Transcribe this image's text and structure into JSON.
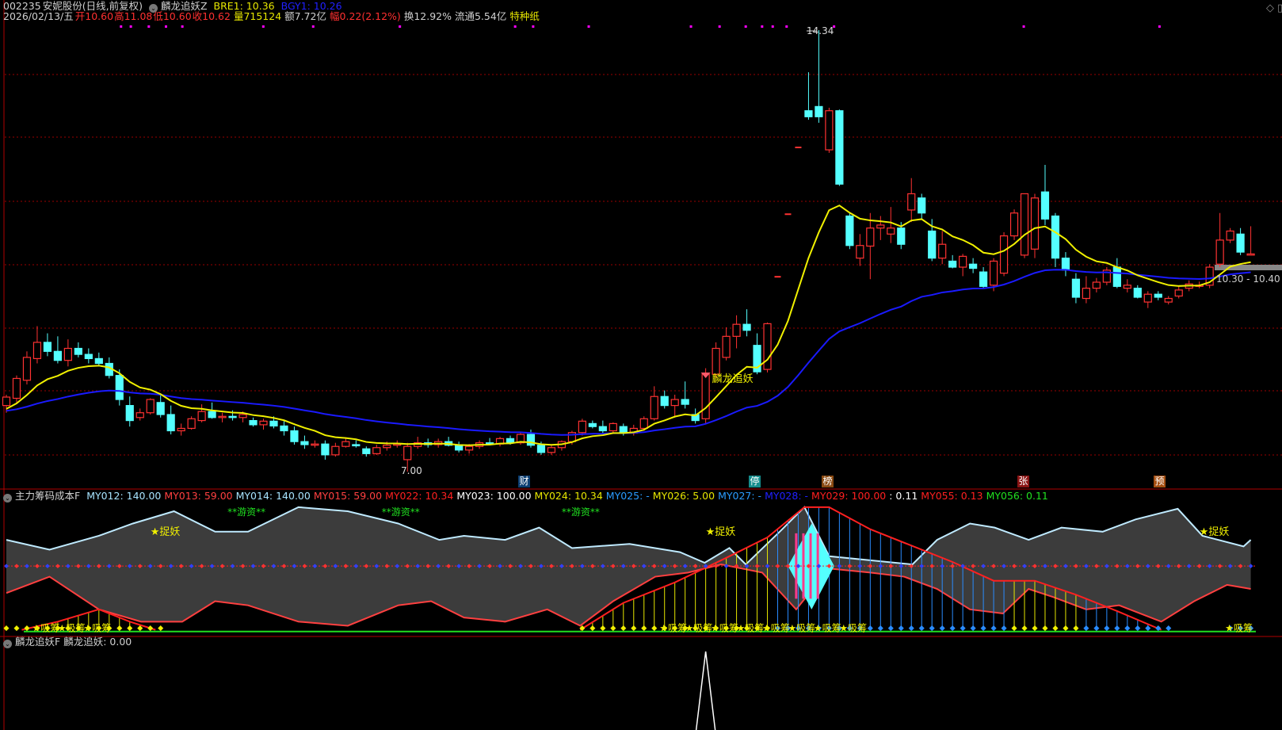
{
  "header": {
    "code": "002235",
    "name": "安妮股份",
    "period": "(日线,前复权)",
    "indicator": "麟龙追妖Z",
    "bre1": "BRE1: 10.36",
    "bgy1": "BGY1: 10.26",
    "date": "2026/02/13/五",
    "open": "开10.60",
    "high": "高11.08",
    "low": "低10.60",
    "close": "收10.62",
    "volume": "量715124",
    "amount": "额7.72亿",
    "change": "幅0.22(2.12%)",
    "turnover": "换12.92%",
    "float": "流通5.54亿",
    "tag": "特种纸"
  },
  "price_labels": {
    "high": "14.34",
    "low": "7.00",
    "range": "10.30 - 10.40",
    "signal": "麟龙追妖"
  },
  "events": [
    {
      "label": "财",
      "color": "#0b3e72"
    },
    {
      "label": "停",
      "color": "#158c8c"
    },
    {
      "label": "榜",
      "color": "#8a4a12"
    },
    {
      "label": "张",
      "color": "#8a1414"
    },
    {
      "label": "预",
      "color": "#a54f12"
    }
  ],
  "indicator_header": {
    "name": "主力筹码成本F",
    "items": [
      {
        "text": "MY012: 140.00",
        "color": "#a8e4ff"
      },
      {
        "text": "MY013: 59.00",
        "color": "#ff4040"
      },
      {
        "text": "MY014: 140.00",
        "color": "#a8e4ff"
      },
      {
        "text": "MY015: 59.00",
        "color": "#ff4040"
      },
      {
        "text": "MY022: 10.34",
        "color": "#ff2020"
      },
      {
        "text": "MY023: 100.00",
        "color": "#ffffff"
      },
      {
        "text": "MY024: 10.34",
        "color": "#e6e600"
      },
      {
        "text": "MY025: -",
        "color": "#2a9cff"
      },
      {
        "text": "MY026: 5.00",
        "color": "#e6e600"
      },
      {
        "text": "MY027: -",
        "color": "#2a9cff"
      },
      {
        "text": "MY028: -",
        "color": "#2020ff"
      },
      {
        "text": "MY029: 100.00",
        "color": "#ff2020"
      },
      {
        "text": ": 0.11",
        "color": "#ffffff"
      },
      {
        "text": "MY055: 0.13",
        "color": "#ff2020"
      },
      {
        "text": "MY056: 0.11",
        "color": "#20e020"
      }
    ],
    "labels": {
      "catch": "★捉妖",
      "hot": "**游资**",
      "absorb": "★吸筹"
    }
  },
  "bottom_header": {
    "name": "麟龙追妖F",
    "value": "麟龙追妖: 0.00"
  },
  "colors": {
    "up": "#ff3232",
    "down": "#54ffff",
    "ma_short": "#f0f000",
    "ma_long": "#1a1aff",
    "grid": "#9a0000"
  },
  "chart_data": {
    "type": "candlestick",
    "ylim": [
      7.0,
      14.34
    ],
    "ohlc": [
      [
        8.1,
        8.28,
        7.98,
        8.24
      ],
      [
        8.22,
        8.6,
        8.15,
        8.55
      ],
      [
        8.52,
        9.0,
        8.45,
        8.9
      ],
      [
        8.88,
        9.42,
        8.8,
        9.15
      ],
      [
        9.15,
        9.3,
        8.92,
        9.0
      ],
      [
        9.0,
        9.25,
        8.8,
        8.85
      ],
      [
        8.85,
        9.2,
        8.75,
        9.05
      ],
      [
        9.05,
        9.15,
        8.9,
        8.95
      ],
      [
        8.95,
        9.05,
        8.8,
        8.88
      ],
      [
        8.88,
        8.98,
        8.75,
        8.8
      ],
      [
        8.8,
        8.9,
        8.55,
        8.6
      ],
      [
        8.6,
        8.7,
        8.1,
        8.2
      ],
      [
        8.1,
        8.25,
        7.75,
        7.85
      ],
      [
        7.9,
        8.05,
        7.85,
        7.98
      ],
      [
        7.98,
        8.22,
        7.95,
        8.2
      ],
      [
        8.15,
        8.3,
        7.9,
        7.95
      ],
      [
        7.95,
        8.1,
        7.62,
        7.68
      ],
      [
        7.68,
        7.8,
        7.6,
        7.72
      ],
      [
        7.72,
        7.92,
        7.7,
        7.88
      ],
      [
        7.85,
        8.12,
        7.82,
        8.0
      ],
      [
        8.0,
        8.15,
        7.88,
        7.9
      ],
      [
        7.9,
        7.98,
        7.82,
        7.92
      ],
      [
        7.92,
        8.02,
        7.85,
        7.9
      ],
      [
        7.9,
        8.0,
        7.82,
        7.95
      ],
      [
        7.85,
        7.9,
        7.75,
        7.78
      ],
      [
        7.78,
        7.88,
        7.7,
        7.84
      ],
      [
        7.84,
        7.92,
        7.72,
        7.76
      ],
      [
        7.76,
        7.85,
        7.6,
        7.68
      ],
      [
        7.68,
        7.75,
        7.45,
        7.5
      ],
      [
        7.5,
        7.6,
        7.38,
        7.45
      ],
      [
        7.45,
        7.52,
        7.4,
        7.46
      ],
      [
        7.46,
        7.52,
        7.2,
        7.28
      ],
      [
        7.28,
        7.48,
        7.25,
        7.42
      ],
      [
        7.42,
        7.55,
        7.4,
        7.5
      ],
      [
        7.45,
        7.52,
        7.4,
        7.44
      ],
      [
        7.38,
        7.42,
        7.25,
        7.3
      ],
      [
        7.3,
        7.45,
        7.28,
        7.4
      ],
      [
        7.4,
        7.5,
        7.35,
        7.44
      ],
      [
        7.44,
        7.52,
        7.4,
        7.46
      ],
      [
        7.2,
        7.48,
        7.0,
        7.42
      ],
      [
        7.42,
        7.58,
        7.38,
        7.48
      ],
      [
        7.48,
        7.55,
        7.4,
        7.45
      ],
      [
        7.45,
        7.55,
        7.4,
        7.5
      ],
      [
        7.5,
        7.58,
        7.42,
        7.44
      ],
      [
        7.44,
        7.5,
        7.32,
        7.36
      ],
      [
        7.36,
        7.46,
        7.3,
        7.42
      ],
      [
        7.42,
        7.52,
        7.38,
        7.48
      ],
      [
        7.48,
        7.56,
        7.44,
        7.46
      ],
      [
        7.46,
        7.58,
        7.42,
        7.55
      ],
      [
        7.55,
        7.6,
        7.45,
        7.48
      ],
      [
        7.48,
        7.66,
        7.45,
        7.62
      ],
      [
        7.62,
        7.7,
        7.4,
        7.44
      ],
      [
        7.44,
        7.5,
        7.28,
        7.32
      ],
      [
        7.32,
        7.45,
        7.28,
        7.4
      ],
      [
        7.4,
        7.52,
        7.35,
        7.5
      ],
      [
        7.5,
        7.68,
        7.45,
        7.65
      ],
      [
        7.65,
        7.88,
        7.6,
        7.84
      ],
      [
        7.8,
        7.85,
        7.72,
        7.75
      ],
      [
        7.75,
        7.85,
        7.62,
        7.68
      ],
      [
        7.68,
        7.82,
        7.64,
        7.8
      ],
      [
        7.75,
        7.8,
        7.6,
        7.64
      ],
      [
        7.64,
        7.78,
        7.6,
        7.72
      ],
      [
        7.72,
        7.92,
        7.68,
        7.88
      ],
      [
        7.88,
        8.42,
        7.85,
        8.25
      ],
      [
        8.25,
        8.35,
        8.05,
        8.1
      ],
      [
        8.1,
        8.28,
        7.9,
        8.2
      ],
      [
        8.2,
        8.5,
        8.05,
        8.12
      ],
      [
        7.95,
        8.05,
        7.8,
        7.85
      ],
      [
        7.88,
        8.72,
        7.8,
        8.62
      ],
      [
        8.62,
        9.15,
        8.55,
        9.05
      ],
      [
        8.9,
        9.4,
        8.85,
        9.25
      ],
      [
        9.25,
        9.6,
        9.05,
        9.45
      ],
      [
        9.45,
        9.7,
        9.25,
        9.35
      ],
      [
        9.1,
        9.3,
        8.62,
        8.66
      ],
      [
        8.7,
        9.48,
        8.65,
        9.46
      ],
      [
        10.24,
        10.24,
        10.24,
        10.24
      ],
      [
        11.28,
        11.28,
        11.28,
        11.28
      ],
      [
        12.39,
        12.39,
        12.39,
        12.39
      ],
      [
        13.0,
        13.64,
        12.85,
        12.9
      ],
      [
        13.07,
        14.34,
        12.8,
        12.9
      ],
      [
        12.35,
        13.05,
        12.3,
        13.0
      ],
      [
        13.0,
        13.02,
        11.75,
        11.78
      ],
      [
        11.25,
        11.3,
        10.7,
        10.76
      ],
      [
        10.55,
        10.95,
        10.42,
        10.76
      ],
      [
        10.75,
        11.3,
        10.2,
        11.05
      ],
      [
        11.05,
        11.25,
        10.85,
        11.1
      ],
      [
        10.95,
        11.4,
        10.8,
        11.05
      ],
      [
        11.05,
        11.15,
        10.7,
        10.78
      ],
      [
        11.35,
        11.88,
        11.15,
        11.62
      ],
      [
        11.55,
        11.62,
        11.2,
        11.3
      ],
      [
        11.0,
        11.2,
        10.5,
        10.55
      ],
      [
        10.55,
        11.0,
        10.45,
        10.78
      ],
      [
        10.5,
        10.6,
        10.38,
        10.4
      ],
      [
        10.4,
        10.62,
        10.25,
        10.58
      ],
      [
        10.45,
        10.55,
        10.3,
        10.38
      ],
      [
        10.32,
        10.4,
        10.05,
        10.08
      ],
      [
        10.1,
        10.55,
        10.0,
        10.5
      ],
      [
        10.3,
        10.98,
        10.25,
        10.92
      ],
      [
        10.92,
        11.36,
        10.85,
        11.3
      ],
      [
        10.6,
        11.62,
        10.55,
        11.62
      ],
      [
        10.7,
        11.62,
        10.55,
        11.55
      ],
      [
        11.65,
        12.1,
        11.1,
        11.2
      ],
      [
        11.25,
        11.3,
        10.4,
        10.55
      ],
      [
        10.55,
        10.65,
        10.25,
        10.35
      ],
      [
        10.2,
        10.3,
        9.8,
        9.9
      ],
      [
        9.88,
        10.25,
        9.8,
        10.05
      ],
      [
        10.05,
        10.22,
        9.98,
        10.15
      ],
      [
        10.15,
        10.4,
        10.1,
        10.35
      ],
      [
        10.4,
        10.55,
        10.05,
        10.08
      ],
      [
        10.05,
        10.2,
        9.98,
        10.1
      ],
      [
        10.05,
        10.1,
        9.88,
        9.9
      ],
      [
        9.82,
        10.0,
        9.72,
        9.95
      ],
      [
        9.95,
        10.0,
        9.85,
        9.9
      ],
      [
        9.82,
        9.92,
        9.78,
        9.88
      ],
      [
        9.92,
        10.08,
        9.88,
        10.02
      ],
      [
        10.05,
        10.18,
        10.0,
        10.12
      ],
      [
        10.1,
        10.16,
        10.05,
        10.1
      ],
      [
        10.1,
        10.45,
        10.05,
        10.4
      ],
      [
        10.45,
        11.3,
        10.4,
        10.85
      ],
      [
        10.85,
        11.05,
        10.8,
        11.0
      ],
      [
        10.95,
        11.05,
        10.6,
        10.65
      ],
      [
        10.6,
        11.08,
        10.6,
        10.62
      ]
    ],
    "indicator": {
      "upper": [
        [
          0,
          32
        ],
        [
          4.2,
          20
        ],
        [
          9,
          37
        ],
        [
          12.3,
          52
        ],
        [
          16.3,
          67
        ],
        [
          20.3,
          42
        ],
        [
          23.5,
          42
        ],
        [
          28.4,
          72
        ],
        [
          33.2,
          67
        ],
        [
          38.1,
          52
        ],
        [
          42.1,
          32
        ],
        [
          44.5,
          37
        ],
        [
          48.5,
          32
        ],
        [
          51.8,
          47
        ],
        [
          55,
          22
        ],
        [
          60.6,
          27
        ],
        [
          65.5,
          17
        ],
        [
          67.9,
          4
        ],
        [
          70.3,
          22
        ],
        [
          71.9,
          2
        ],
        [
          75.2,
          42
        ],
        [
          77.6,
          72
        ],
        [
          80,
          12
        ],
        [
          84,
          7
        ],
        [
          88.1,
          2
        ],
        [
          90.5,
          32
        ],
        [
          93.7,
          52
        ],
        [
          96.1,
          47
        ],
        [
          99.4,
          32
        ],
        [
          102.6,
          47
        ],
        [
          106.6,
          42
        ],
        [
          109.8,
          57
        ],
        [
          113.9,
          70
        ],
        [
          116.3,
          37
        ],
        [
          120.3,
          24
        ],
        [
          121,
          32
        ]
      ],
      "lower": [
        [
          0,
          -33
        ],
        [
          4.2,
          -13
        ],
        [
          9,
          -53
        ],
        [
          13.1,
          -68
        ],
        [
          17.1,
          -68
        ],
        [
          20.3,
          -43
        ],
        [
          23.5,
          -48
        ],
        [
          28.4,
          -68
        ],
        [
          33.2,
          -73
        ],
        [
          38.1,
          -48
        ],
        [
          41.3,
          -43
        ],
        [
          44.5,
          -63
        ],
        [
          48.5,
          -68
        ],
        [
          52.6,
          -53
        ],
        [
          55.8,
          -73
        ],
        [
          59,
          -43
        ],
        [
          63.1,
          -13
        ],
        [
          66.3,
          -8
        ],
        [
          69.5,
          2
        ],
        [
          73.5,
          -8
        ],
        [
          76.8,
          -53
        ],
        [
          80,
          -3
        ],
        [
          84,
          -8
        ],
        [
          87.3,
          -13
        ],
        [
          90.5,
          -28
        ],
        [
          93.7,
          -53
        ],
        [
          96.9,
          -58
        ],
        [
          99.4,
          -28
        ],
        [
          101.8,
          -38
        ],
        [
          105,
          -53
        ],
        [
          108.2,
          -48
        ],
        [
          112.3,
          -68
        ],
        [
          115.5,
          -43
        ],
        [
          118.7,
          -23
        ],
        [
          121,
          -28
        ]
      ],
      "cost_curve": [
        [
          55.8,
          -78
        ],
        [
          60,
          -45
        ],
        [
          65,
          -20
        ],
        [
          70,
          10
        ],
        [
          74,
          35
        ],
        [
          77.6,
          72
        ],
        [
          80,
          72
        ],
        [
          84,
          45
        ],
        [
          88,
          25
        ],
        [
          92,
          5
        ],
        [
          96,
          -18
        ],
        [
          100,
          -18
        ],
        [
          104,
          -35
        ],
        [
          108,
          -55
        ],
        [
          112.3,
          -78
        ]
      ],
      "cost_curve_early": [
        [
          1.5,
          -78
        ],
        [
          5,
          -68
        ],
        [
          9,
          -53
        ],
        [
          12,
          -68
        ],
        [
          14.5,
          -78
        ]
      ]
    },
    "signal": {
      "index": 68,
      "peak": 1
    }
  }
}
